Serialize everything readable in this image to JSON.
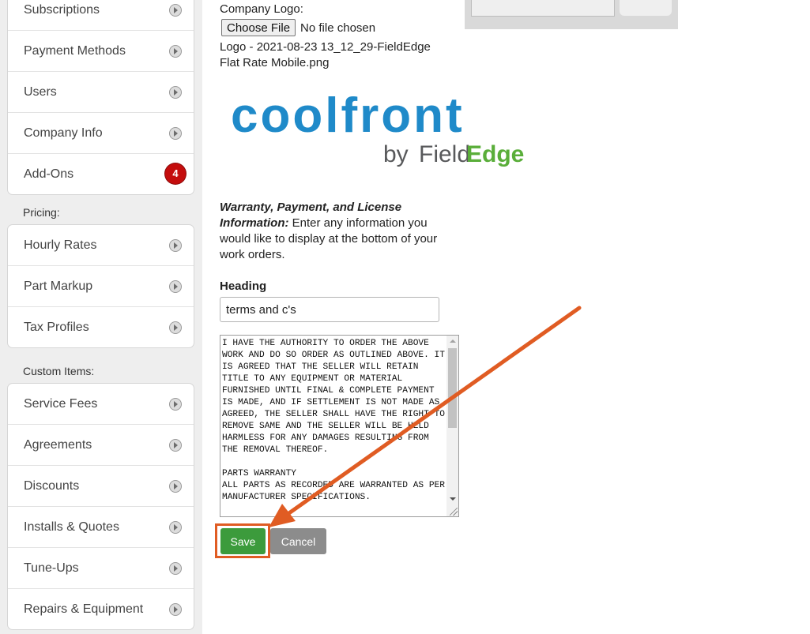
{
  "sidebar": {
    "top_items": [
      {
        "label": "Subscriptions"
      },
      {
        "label": "Payment Methods"
      },
      {
        "label": "Users"
      },
      {
        "label": "Company Info"
      },
      {
        "label": "Add-Ons",
        "badge": "4"
      }
    ],
    "pricing": {
      "label": "Pricing:",
      "items": [
        {
          "label": "Hourly Rates"
        },
        {
          "label": "Part Markup"
        },
        {
          "label": "Tax Profiles"
        }
      ]
    },
    "custom_items": {
      "label": "Custom Items:",
      "items": [
        {
          "label": "Service Fees"
        },
        {
          "label": "Agreements"
        },
        {
          "label": "Discounts"
        },
        {
          "label": "Installs & Quotes"
        },
        {
          "label": "Tune-Ups"
        },
        {
          "label": "Repairs & Equipment"
        }
      ]
    },
    "colors": {
      "badge": "#c40d0d",
      "arrow": "#dcdcdc"
    }
  },
  "form": {
    "logo": {
      "label": "Company Logo:",
      "choose_button": "Choose File",
      "file_status": "No file chosen",
      "filename": "Logo - 2021-08-23 13_12_29-FieldEdge Flat Rate Mobile.png",
      "image": {
        "brand_word": "coolfront",
        "by": "by",
        "field": "Field",
        "edge": "Edge"
      }
    },
    "warranty": {
      "title": "Warranty, Payment, and License Information:",
      "description": " Enter any information you would like to display at the bottom of your work orders."
    },
    "heading": {
      "label": "Heading",
      "value": "terms and c's"
    },
    "terms": "I HAVE THE AUTHORITY TO ORDER THE ABOVE WORK AND DO SO ORDER AS OUTLINED ABOVE. IT IS AGREED THAT THE SELLER WILL RETAIN TITLE TO ANY EQUIPMENT OR MATERIAL FURNISHED UNTIL FINAL & COMPLETE PAYMENT IS MADE, AND IF SETTLEMENT IS NOT MADE AS AGREED, THE SELLER SHALL HAVE THE RIGHT TO REMOVE SAME AND THE SELLER WILL BE HELD HARMLESS FOR ANY DAMAGES RESULTING FROM THE REMOVAL THEREOF.\n\nPARTS WARRANTY\nALL PARTS AS RECORDED ARE WARRANTED AS PER MANUFACTURER SPECIFICATIONS.",
    "save_label": "Save",
    "cancel_label": "Cancel"
  },
  "colors": {
    "save": "#3c9b3c",
    "cancel": "#8c8c8c",
    "annotation": "#e05c23",
    "logo_blue": "#1f8ac9",
    "logo_gray": "#58595b",
    "logo_green": "#5aae3a"
  }
}
